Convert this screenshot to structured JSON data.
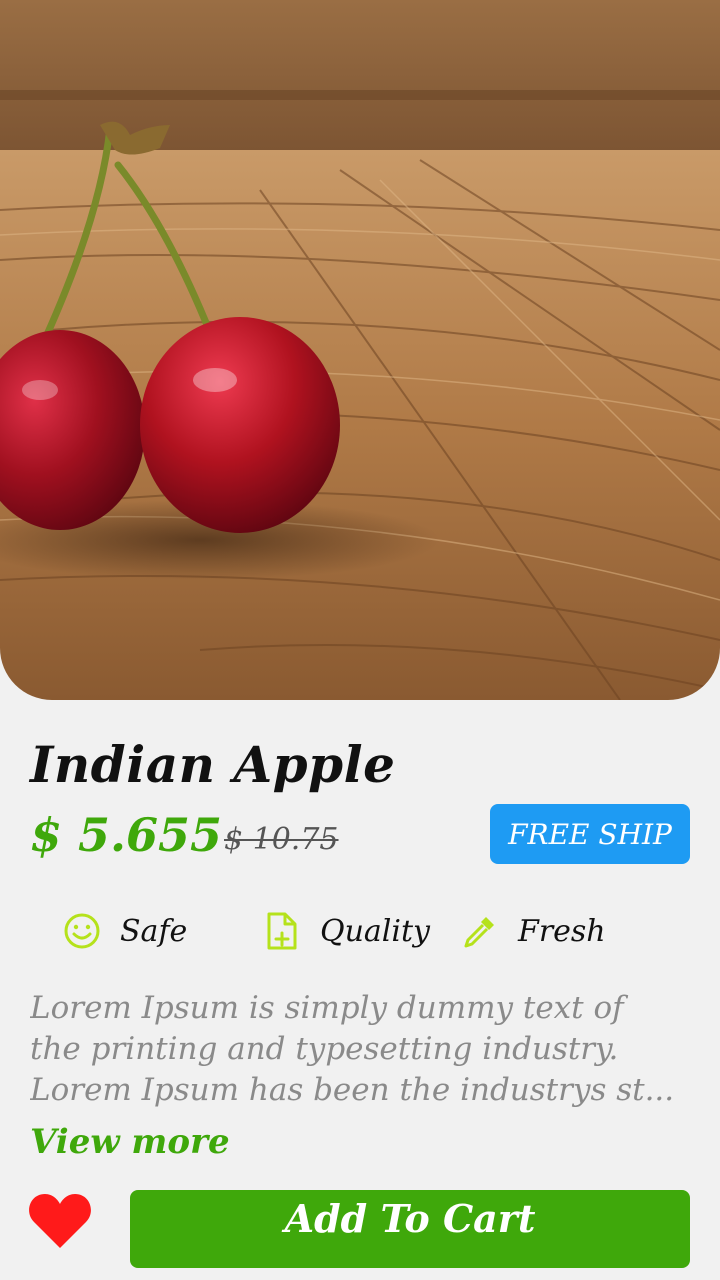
{
  "product": {
    "title": "Indian Apple",
    "price": "$ 5.655",
    "old_price": "$ 10.75",
    "free_ship_label": "FREE SHIP"
  },
  "features": [
    {
      "label": "Safe",
      "icon": "smiley-icon"
    },
    {
      "label": "Quality",
      "icon": "document-add-icon"
    },
    {
      "label": "Fresh",
      "icon": "pipette-icon"
    }
  ],
  "description": {
    "lines": [
      "Lorem Ipsum is simply dummy text of",
      "the printing and typesetting industry.",
      "Lorem Ipsum has been the industrys st..."
    ],
    "view_more_label": "View more"
  },
  "actions": {
    "add_to_cart_label": "Add To Cart",
    "favorite_icon": "heart-icon"
  },
  "colors": {
    "accent_green": "#3fa80b",
    "free_ship_blue": "#1e9bf3",
    "icon_lime": "#b5e21b",
    "heart_red": "#ff1a1a"
  }
}
